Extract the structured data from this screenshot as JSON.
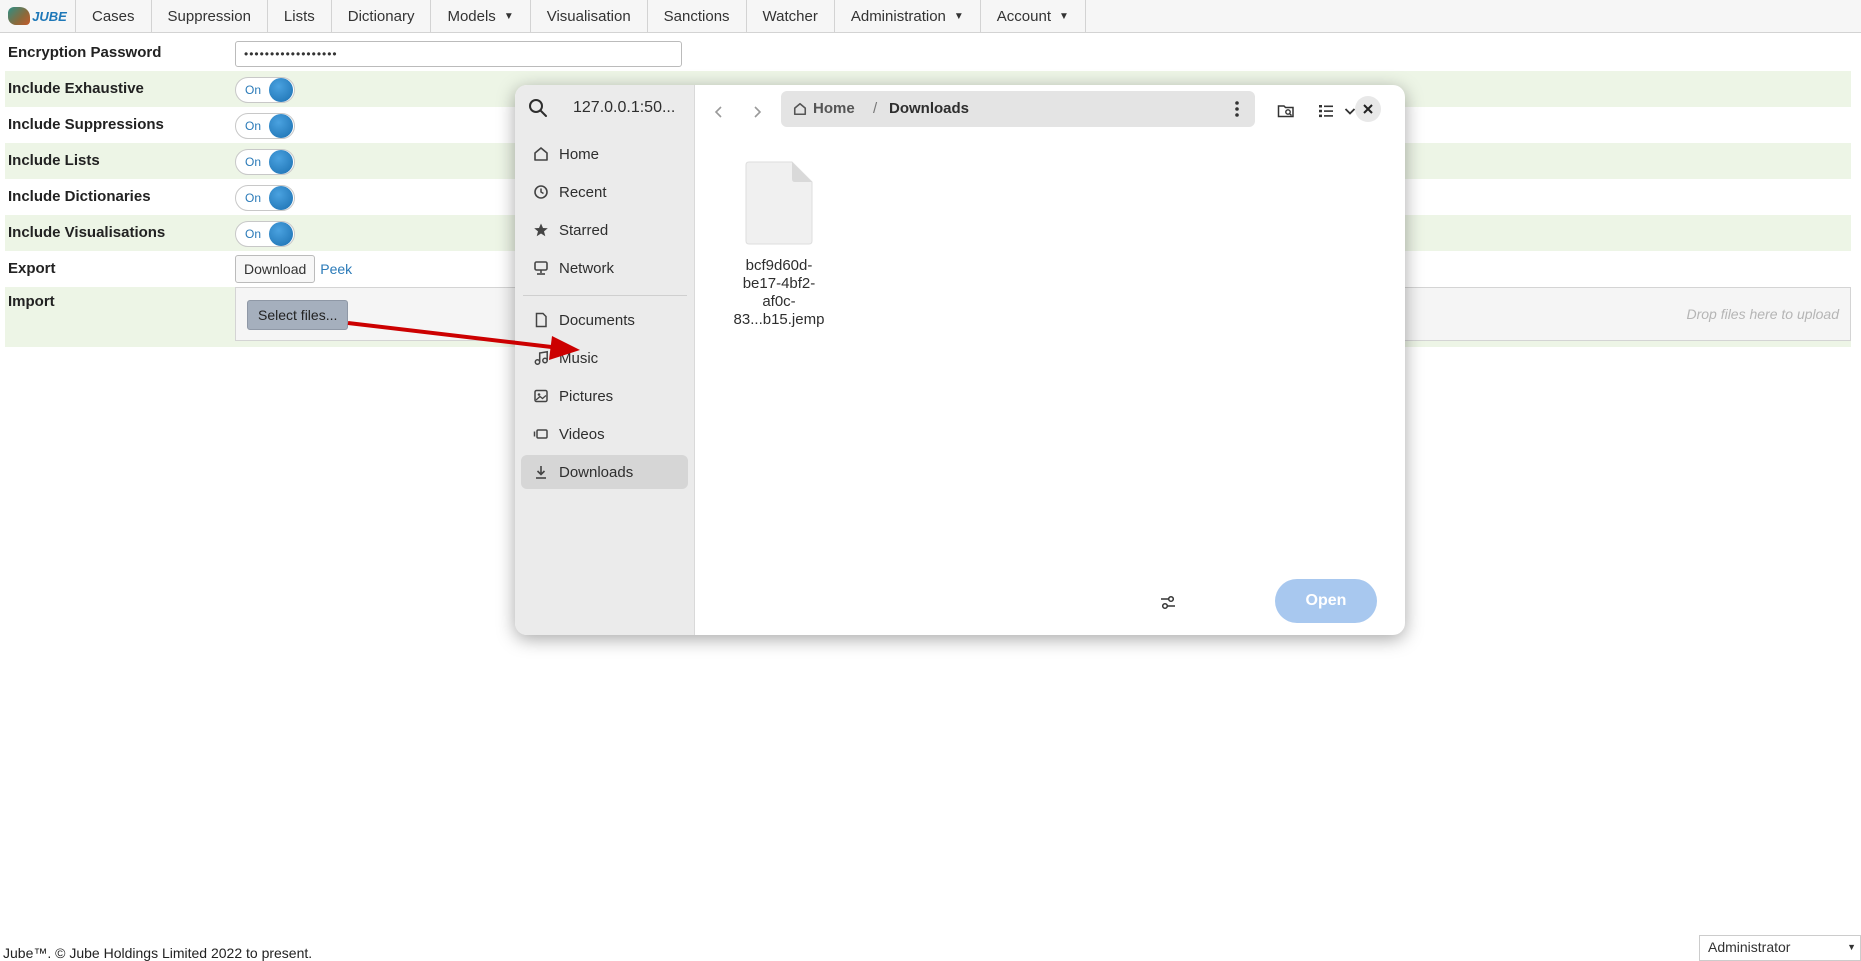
{
  "menu": {
    "logo_text": "JUBE",
    "items": [
      {
        "label": "Cases",
        "dropdown": false
      },
      {
        "label": "Suppression",
        "dropdown": false
      },
      {
        "label": "Lists",
        "dropdown": false
      },
      {
        "label": "Dictionary",
        "dropdown": false
      },
      {
        "label": "Models",
        "dropdown": true
      },
      {
        "label": "Visualisation",
        "dropdown": false
      },
      {
        "label": "Sanctions",
        "dropdown": false
      },
      {
        "label": "Watcher",
        "dropdown": false
      },
      {
        "label": "Administration",
        "dropdown": true
      },
      {
        "label": "Account",
        "dropdown": true
      }
    ]
  },
  "form": {
    "encryption_label": "Encryption Password",
    "encryption_value": "••••••••••••••••••",
    "toggles": [
      {
        "label": "Include Exhaustive",
        "state": "On"
      },
      {
        "label": "Include Suppressions",
        "state": "On"
      },
      {
        "label": "Include Lists",
        "state": "On"
      },
      {
        "label": "Include Dictionaries",
        "state": "On"
      },
      {
        "label": "Include Visualisations",
        "state": "On"
      }
    ],
    "export_label": "Export",
    "download_label": "Download",
    "peek_label": "Peek",
    "import_label": "Import",
    "select_files_label": "Select files...",
    "drop_hint": "Drop files here to upload"
  },
  "footer": {
    "copyright": "Jube™. © Jube Holdings Limited 2022 to present.",
    "role_selected": "Administrator"
  },
  "dialog": {
    "title": "127.0.0.1:50...",
    "places": [
      {
        "label": "Home",
        "icon": "home-icon"
      },
      {
        "label": "Recent",
        "icon": "clock-icon"
      },
      {
        "label": "Starred",
        "icon": "star-icon"
      },
      {
        "label": "Network",
        "icon": "network-icon"
      },
      {
        "label": "Documents",
        "icon": "document-icon"
      },
      {
        "label": "Music",
        "icon": "music-icon"
      },
      {
        "label": "Pictures",
        "icon": "picture-icon"
      },
      {
        "label": "Videos",
        "icon": "video-icon"
      },
      {
        "label": "Downloads",
        "icon": "download-icon",
        "active": true
      }
    ],
    "breadcrumb_home": "Home",
    "breadcrumb_separator": "/",
    "breadcrumb_current": "Downloads",
    "file_name_lines": [
      "bcf9d60d-",
      "be17-4bf2-",
      "af0c-83...b15.jemp"
    ],
    "open_label": "Open"
  },
  "colors": {
    "accent_blue": "#2a7ab8",
    "row_alt": "#edf5e6",
    "open_button": "#a8c8ef",
    "annotation_arrow": "#cc0000"
  }
}
